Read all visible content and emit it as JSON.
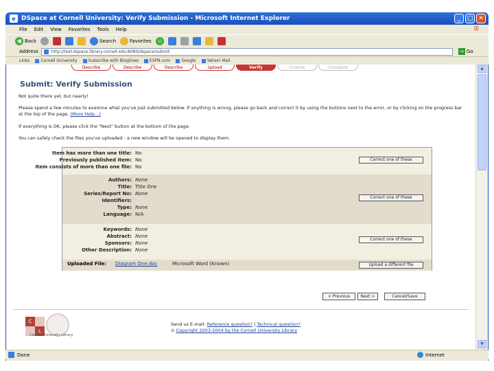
{
  "window": {
    "title": "DSpace at Cornell University: Verify Submission - Microsoft Internet Explorer",
    "minimize": "_",
    "maximize": "□",
    "close": "✕"
  },
  "menubar": [
    "File",
    "Edit",
    "View",
    "Favorites",
    "Tools",
    "Help"
  ],
  "toolbar": {
    "back": "Back",
    "search": "Search",
    "favorites": "Favorites"
  },
  "addressbar": {
    "label": "Address",
    "url": "http://test-dspace.library.cornell.edu:8080/dspace/submit",
    "go": "Go"
  },
  "linksbar": {
    "label": "Links",
    "items": [
      "Cornell University",
      "Subscribe with Bloglines",
      "ESPN.com",
      "Google",
      "Yahoo! Mail"
    ]
  },
  "progress": {
    "steps": [
      "Describe",
      "Describe",
      "Describe",
      "Upload",
      "Verify",
      "License",
      "Complete"
    ]
  },
  "page": {
    "title": "Submit: Verify Submission",
    "p1": "Not quite there yet, but nearly!",
    "p2a": "Please spend a few minutes to examine what you've just submitted below. If anything is wrong, please go back and correct it by using the buttons next to the error, or by clicking on the progress bar at the top of the page.",
    "p2link": "(More Help...)",
    "p3": "If everything is OK, please click the \"Next\" button at the bottom of the page.",
    "p4": "You can safely check the files you've uploaded - a new window will be opened to display them."
  },
  "review": {
    "section1": [
      {
        "label": "Item has more than one title:",
        "value": "No"
      },
      {
        "label": "Previously published item:",
        "value": "No"
      },
      {
        "label": "Item consists of more than one file:",
        "value": "No"
      }
    ],
    "section2": [
      {
        "label": "Authors:",
        "value": "None"
      },
      {
        "label": "Title:",
        "value": "Title One"
      },
      {
        "label": "Series/Report No:",
        "value": "None"
      },
      {
        "label": "Identifiers:",
        "value": ""
      },
      {
        "label": "Type:",
        "value": "None"
      },
      {
        "label": "Language:",
        "value": "N/A"
      }
    ],
    "section3": [
      {
        "label": "Keywords:",
        "value": "None"
      },
      {
        "label": "Abstract:",
        "value": "None"
      },
      {
        "label": "Sponsors:",
        "value": "None"
      },
      {
        "label": "Other Description:",
        "value": "None"
      }
    ],
    "correct_label": "Correct one of these",
    "uploaded_label": "Uploaded File:",
    "uploaded_file": "Diagram One.doc",
    "uploaded_format": "Microsoft Word (Known)",
    "upload_different": "Upload a different file"
  },
  "nav": {
    "previous": "< Previous",
    "next": "Next >",
    "cancel": "Cancel/Save"
  },
  "footer": {
    "send_email": "Send us E-mail:",
    "reference": "Reference question?",
    "separator": "|",
    "technical": "Technical question?",
    "copyright": "Copyright 2003-2004 by the Cornell University Library",
    "library": "Cornell University Library"
  },
  "statusbar": {
    "status": "Done",
    "zone": "Internet"
  }
}
